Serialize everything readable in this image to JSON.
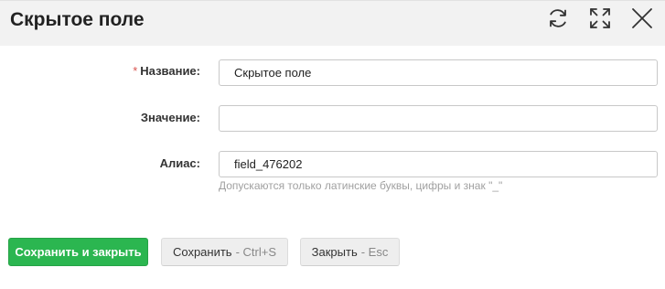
{
  "dialog": {
    "title": "Скрытое поле"
  },
  "header": {
    "icons": [
      "refresh-icon",
      "expand-icon",
      "close-icon"
    ]
  },
  "form": {
    "name": {
      "required_mark": "*",
      "label": "Название:",
      "value": "Скрытое поле"
    },
    "value": {
      "label": "Значение:",
      "value": ""
    },
    "alias": {
      "label": "Алиас:",
      "value": "field_476202",
      "hint": "Допускаются только латинские буквы, цифры и знак \"_\""
    }
  },
  "actions": {
    "save_close_label": "Сохранить и закрыть",
    "save_label": "Сохранить",
    "save_shortcut": "- Ctrl+S",
    "close_label": "Закрыть",
    "close_shortcut": "- Esc"
  },
  "colors": {
    "primary": "#2bb650",
    "required": "#d9534f",
    "header_bg": "#f2f2f2"
  }
}
